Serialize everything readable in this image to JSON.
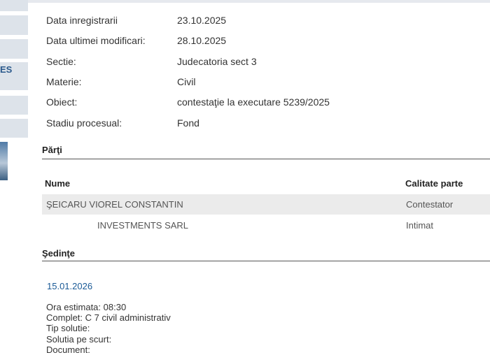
{
  "sidebar": {
    "partial_label": "ES"
  },
  "details": [
    {
      "label": "Data inregistrarii",
      "value": "23.10.2025"
    },
    {
      "label": "Data ultimei modificari:",
      "value": "28.10.2025"
    },
    {
      "label": "Sectie:",
      "value": "Judecatoria sect 3"
    },
    {
      "label": "Materie:",
      "value": "Civil"
    },
    {
      "label": "Obiect:",
      "value": "contestaţie la executare 5239/2025"
    },
    {
      "label": "Stadiu procesual:",
      "value": "Fond"
    }
  ],
  "parti": {
    "title": "Părţi",
    "columns": {
      "name": "Nume",
      "role": "Calitate parte"
    },
    "rows": [
      {
        "name": "ŞEICARU VIOREL CONSTANTIN",
        "role": "Contestator"
      },
      {
        "name": "INVESTMENTS SARL",
        "role": "Intimat"
      }
    ]
  },
  "sedinte": {
    "title": "Şedinţe",
    "date": "15.01.2026",
    "lines": [
      "Ora estimata: 08:30",
      "Complet: C 7 civil administrativ",
      "Tip solutie:",
      "Solutia pe scurt:",
      "Document:"
    ]
  }
}
